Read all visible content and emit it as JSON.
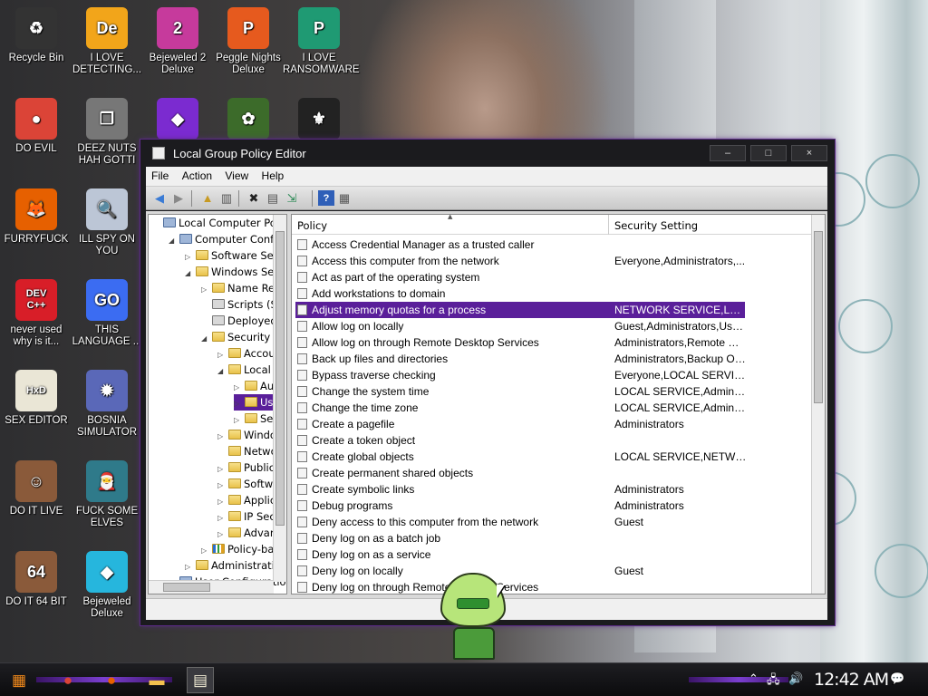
{
  "desktop": {
    "icons": [
      {
        "label": "Recycle Bin",
        "icon": "recycle-bin-icon",
        "glyph": "♻",
        "bg": "#333"
      },
      {
        "label": "I LOVE DETECTING...",
        "icon": "detect-it-easy-icon",
        "glyph": "De",
        "bg": "#f2a51a"
      },
      {
        "label": "Bejeweled 2 Deluxe",
        "icon": "bejeweled-2-icon",
        "glyph": "2",
        "bg": "#c63a9c"
      },
      {
        "label": "Peggle Nights Deluxe",
        "icon": "peggle-nights-icon",
        "glyph": "P",
        "bg": "#e65a1e"
      },
      {
        "label": "I LOVE RANSOMWARE",
        "icon": "publisher-icon",
        "glyph": "P",
        "bg": "#1f9a73"
      },
      {
        "label": "DO EVIL",
        "icon": "chrome-icon",
        "glyph": "●",
        "bg": "#db4437"
      },
      {
        "label": "DEEZ NUTS HAH GOTTI",
        "icon": "windows-copy-icon",
        "glyph": "❐",
        "bg": "#777"
      },
      {
        "label": "",
        "icon": "bejeweled-3-icon",
        "glyph": "◆",
        "bg": "#7b2bd0"
      },
      {
        "label": "",
        "icon": "plant-icon",
        "glyph": "✿",
        "bg": "#3c6b2a"
      },
      {
        "label": "",
        "icon": "ggpk-icon",
        "glyph": "⚜",
        "bg": "#222"
      },
      {
        "label": "FURRYFUCK",
        "icon": "firefox-icon",
        "glyph": "🦊",
        "bg": "#e66000"
      },
      {
        "label": "ILL SPY ON YOU",
        "icon": "magnifier-icon",
        "glyph": "🔍",
        "bg": "#bcc6d6"
      },
      {
        "label": "never used why is it...",
        "icon": "devcpp-icon",
        "glyph": "DEV C++",
        "bg": "#d81e28"
      },
      {
        "label": "THIS LANGUAGE ...",
        "icon": "goland-icon",
        "glyph": "GO",
        "bg": "#3b6cf2"
      },
      {
        "label": "SEX EDITOR",
        "icon": "hxd-icon",
        "glyph": "HxD",
        "bg": "#eae6d6"
      },
      {
        "label": "BOSNIA SIMULATOR",
        "icon": "mine-icon",
        "glyph": "✹",
        "bg": "#5a68b8"
      },
      {
        "label": "DO IT LIVE",
        "icon": "portrait-icon",
        "glyph": "☺",
        "bg": "#8a5a3a"
      },
      {
        "label": "FUCK SOME ELVES",
        "icon": "santa-icon",
        "glyph": "🎅",
        "bg": "#2f7a8a"
      },
      {
        "label": "DO IT 64 BIT",
        "icon": "portrait-64-icon",
        "glyph": "64",
        "bg": "#8a5a3a"
      },
      {
        "label": "Bejeweled Deluxe",
        "icon": "diamond-icon",
        "glyph": "◆",
        "bg": "#26b6dd"
      }
    ]
  },
  "window": {
    "title": "Local Group Policy Editor",
    "controls": {
      "minimize": "–",
      "maximize": "□",
      "close": "×"
    },
    "menu": [
      "File",
      "Action",
      "View",
      "Help"
    ],
    "toolbar": [
      {
        "name": "back-icon",
        "glyph": "◀",
        "color": "#3a7bd5"
      },
      {
        "name": "forward-icon",
        "glyph": "▶",
        "color": "#888"
      },
      {
        "name": "up-folder-icon",
        "glyph": "▲",
        "color": "#c79a23"
      },
      {
        "name": "show-hide-tree-icon",
        "glyph": "▥",
        "color": "#555"
      },
      {
        "name": "delete-icon",
        "glyph": "✖",
        "color": "#222"
      },
      {
        "name": "properties-icon",
        "glyph": "▤",
        "color": "#555"
      },
      {
        "name": "export-list-icon",
        "glyph": "⇲",
        "color": "#2e8b57"
      },
      {
        "name": "help-icon",
        "glyph": "?",
        "color": "#fff"
      },
      {
        "name": "show-action-pane-icon",
        "glyph": "▦",
        "color": "#555"
      }
    ],
    "tree": [
      {
        "label": "Local Computer Policy",
        "indent": 0,
        "exp": "",
        "icon": "computer-policy-icon"
      },
      {
        "label": "Computer Configuration",
        "indent": 1,
        "exp": "◢",
        "icon": "computer-icon"
      },
      {
        "label": "Software Settings",
        "indent": 2,
        "exp": "▷",
        "icon": "folder-icon"
      },
      {
        "label": "Windows Settings",
        "indent": 2,
        "exp": "◢",
        "icon": "folder-icon"
      },
      {
        "label": "Name Resolution Policy",
        "indent": 3,
        "exp": "▷",
        "icon": "folder-icon"
      },
      {
        "label": "Scripts (Startup/Shutdown)",
        "indent": 3,
        "exp": "",
        "icon": "scripts-icon"
      },
      {
        "label": "Deployed Printers",
        "indent": 3,
        "exp": "",
        "icon": "printer-icon"
      },
      {
        "label": "Security Settings",
        "indent": 3,
        "exp": "◢",
        "icon": "security-icon"
      },
      {
        "label": "Account Policies",
        "indent": 4,
        "exp": "▷",
        "icon": "folder-lock-icon"
      },
      {
        "label": "Local Policies",
        "indent": 4,
        "exp": "◢",
        "icon": "folder-lock-icon"
      },
      {
        "label": "Audit Policy",
        "indent": 5,
        "exp": "▷",
        "icon": "folder-lock-icon"
      },
      {
        "label": "User Rights Assignment",
        "indent": 5,
        "exp": "▷",
        "icon": "folder-lock-icon",
        "selected": true
      },
      {
        "label": "Security Options",
        "indent": 5,
        "exp": "▷",
        "icon": "folder-lock-icon"
      },
      {
        "label": "Windows Firewall with Advanced Security",
        "indent": 4,
        "exp": "▷",
        "icon": "folder-icon"
      },
      {
        "label": "Network List Manager Policies",
        "indent": 4,
        "exp": "",
        "icon": "folder-icon"
      },
      {
        "label": "Public Key Policies",
        "indent": 4,
        "exp": "▷",
        "icon": "folder-icon"
      },
      {
        "label": "Software Restriction Policies",
        "indent": 4,
        "exp": "▷",
        "icon": "folder-icon"
      },
      {
        "label": "Application Control Policies",
        "indent": 4,
        "exp": "▷",
        "icon": "folder-icon"
      },
      {
        "label": "IP Security Policies on Local Computer",
        "indent": 4,
        "exp": "▷",
        "icon": "ip-security-icon"
      },
      {
        "label": "Advanced Audit Policy Configuration",
        "indent": 4,
        "exp": "▷",
        "icon": "folder-icon"
      },
      {
        "label": "Policy-based QoS",
        "indent": 3,
        "exp": "▷",
        "icon": "chart-icon"
      },
      {
        "label": "Administrative Templates",
        "indent": 2,
        "exp": "▷",
        "icon": "folder-icon"
      },
      {
        "label": "User Configuration",
        "indent": 1,
        "exp": "",
        "icon": "user-icon"
      }
    ],
    "list": {
      "headers": {
        "policy": "Policy",
        "setting": "Security Setting"
      },
      "rows": [
        {
          "policy": "Access Credential Manager as a trusted caller",
          "setting": ""
        },
        {
          "policy": "Access this computer from the network",
          "setting": "Everyone,Administrators,..."
        },
        {
          "policy": "Act as part of the operating system",
          "setting": ""
        },
        {
          "policy": "Add workstations to domain",
          "setting": ""
        },
        {
          "policy": "Adjust memory quotas for a process",
          "setting": "NETWORK SERVICE,LOCAL...",
          "selected": true
        },
        {
          "policy": "Allow log on locally",
          "setting": "Guest,Administrators,User..."
        },
        {
          "policy": "Allow log on through Remote Desktop Services",
          "setting": "Administrators,Remote De..."
        },
        {
          "policy": "Back up files and directories",
          "setting": "Administrators,Backup Op..."
        },
        {
          "policy": "Bypass traverse checking",
          "setting": "Everyone,LOCAL SERVICE..."
        },
        {
          "policy": "Change the system time",
          "setting": "LOCAL SERVICE,Administr..."
        },
        {
          "policy": "Change the time zone",
          "setting": "LOCAL SERVICE,Administr..."
        },
        {
          "policy": "Create a pagefile",
          "setting": "Administrators"
        },
        {
          "policy": "Create a token object",
          "setting": ""
        },
        {
          "policy": "Create global objects",
          "setting": "LOCAL SERVICE,NETWORK..."
        },
        {
          "policy": "Create permanent shared objects",
          "setting": ""
        },
        {
          "policy": "Create symbolic links",
          "setting": "Administrators"
        },
        {
          "policy": "Debug programs",
          "setting": "Administrators"
        },
        {
          "policy": "Deny access to this computer from the network",
          "setting": "Guest"
        },
        {
          "policy": "Deny log on as a batch job",
          "setting": ""
        },
        {
          "policy": "Deny log on as a service",
          "setting": ""
        },
        {
          "policy": "Deny log on locally",
          "setting": "Guest"
        },
        {
          "policy": "Deny log on through Remote Desktop Services",
          "setting": ""
        }
      ]
    }
  },
  "taskbar": {
    "apps": [
      {
        "name": "start-button-icon",
        "glyph": "▦",
        "color": "#f28a1b"
      },
      {
        "name": "chrome-taskbar-icon",
        "glyph": "●",
        "color": "#db4437"
      },
      {
        "name": "firefox-taskbar-icon",
        "glyph": "●",
        "color": "#e66000"
      },
      {
        "name": "explorer-taskbar-icon",
        "glyph": "▬",
        "color": "#f2c14e"
      },
      {
        "name": "gpedit-taskbar-icon",
        "glyph": "▤",
        "color": "#f5f0d8"
      }
    ],
    "clock": "12:42 AM",
    "tray": [
      {
        "name": "show-hidden-icons-icon",
        "glyph": "⌃"
      },
      {
        "name": "network-icon",
        "glyph": "🖧"
      },
      {
        "name": "volume-icon",
        "glyph": "🔊"
      },
      {
        "name": "notifications-icon",
        "glyph": "💬"
      }
    ]
  },
  "colors": {
    "accent": "#5a1f9a",
    "selection": "#5a1f9a",
    "window_border": "#5b2a86"
  }
}
